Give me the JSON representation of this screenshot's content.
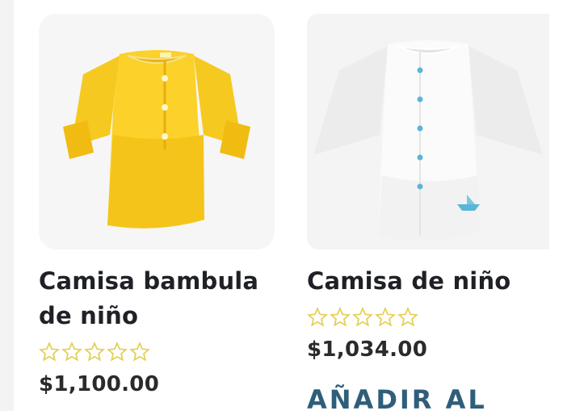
{
  "products": [
    {
      "name": "Camisa bambula de niño",
      "rating": 0,
      "rating_max": 5,
      "price": "$1,100.00",
      "image_icon": "yellow-shirt-image"
    },
    {
      "name": "Camisa de niño",
      "rating": 0,
      "rating_max": 5,
      "price": "$1,034.00",
      "image_icon": "white-shirt-image",
      "add_to_cart_label": "AÑADIR AL"
    }
  ],
  "colors": {
    "star": "#e4cf55",
    "title": "#1f2127",
    "price": "#2b2b2b",
    "button_text": "#2f5e7a"
  }
}
